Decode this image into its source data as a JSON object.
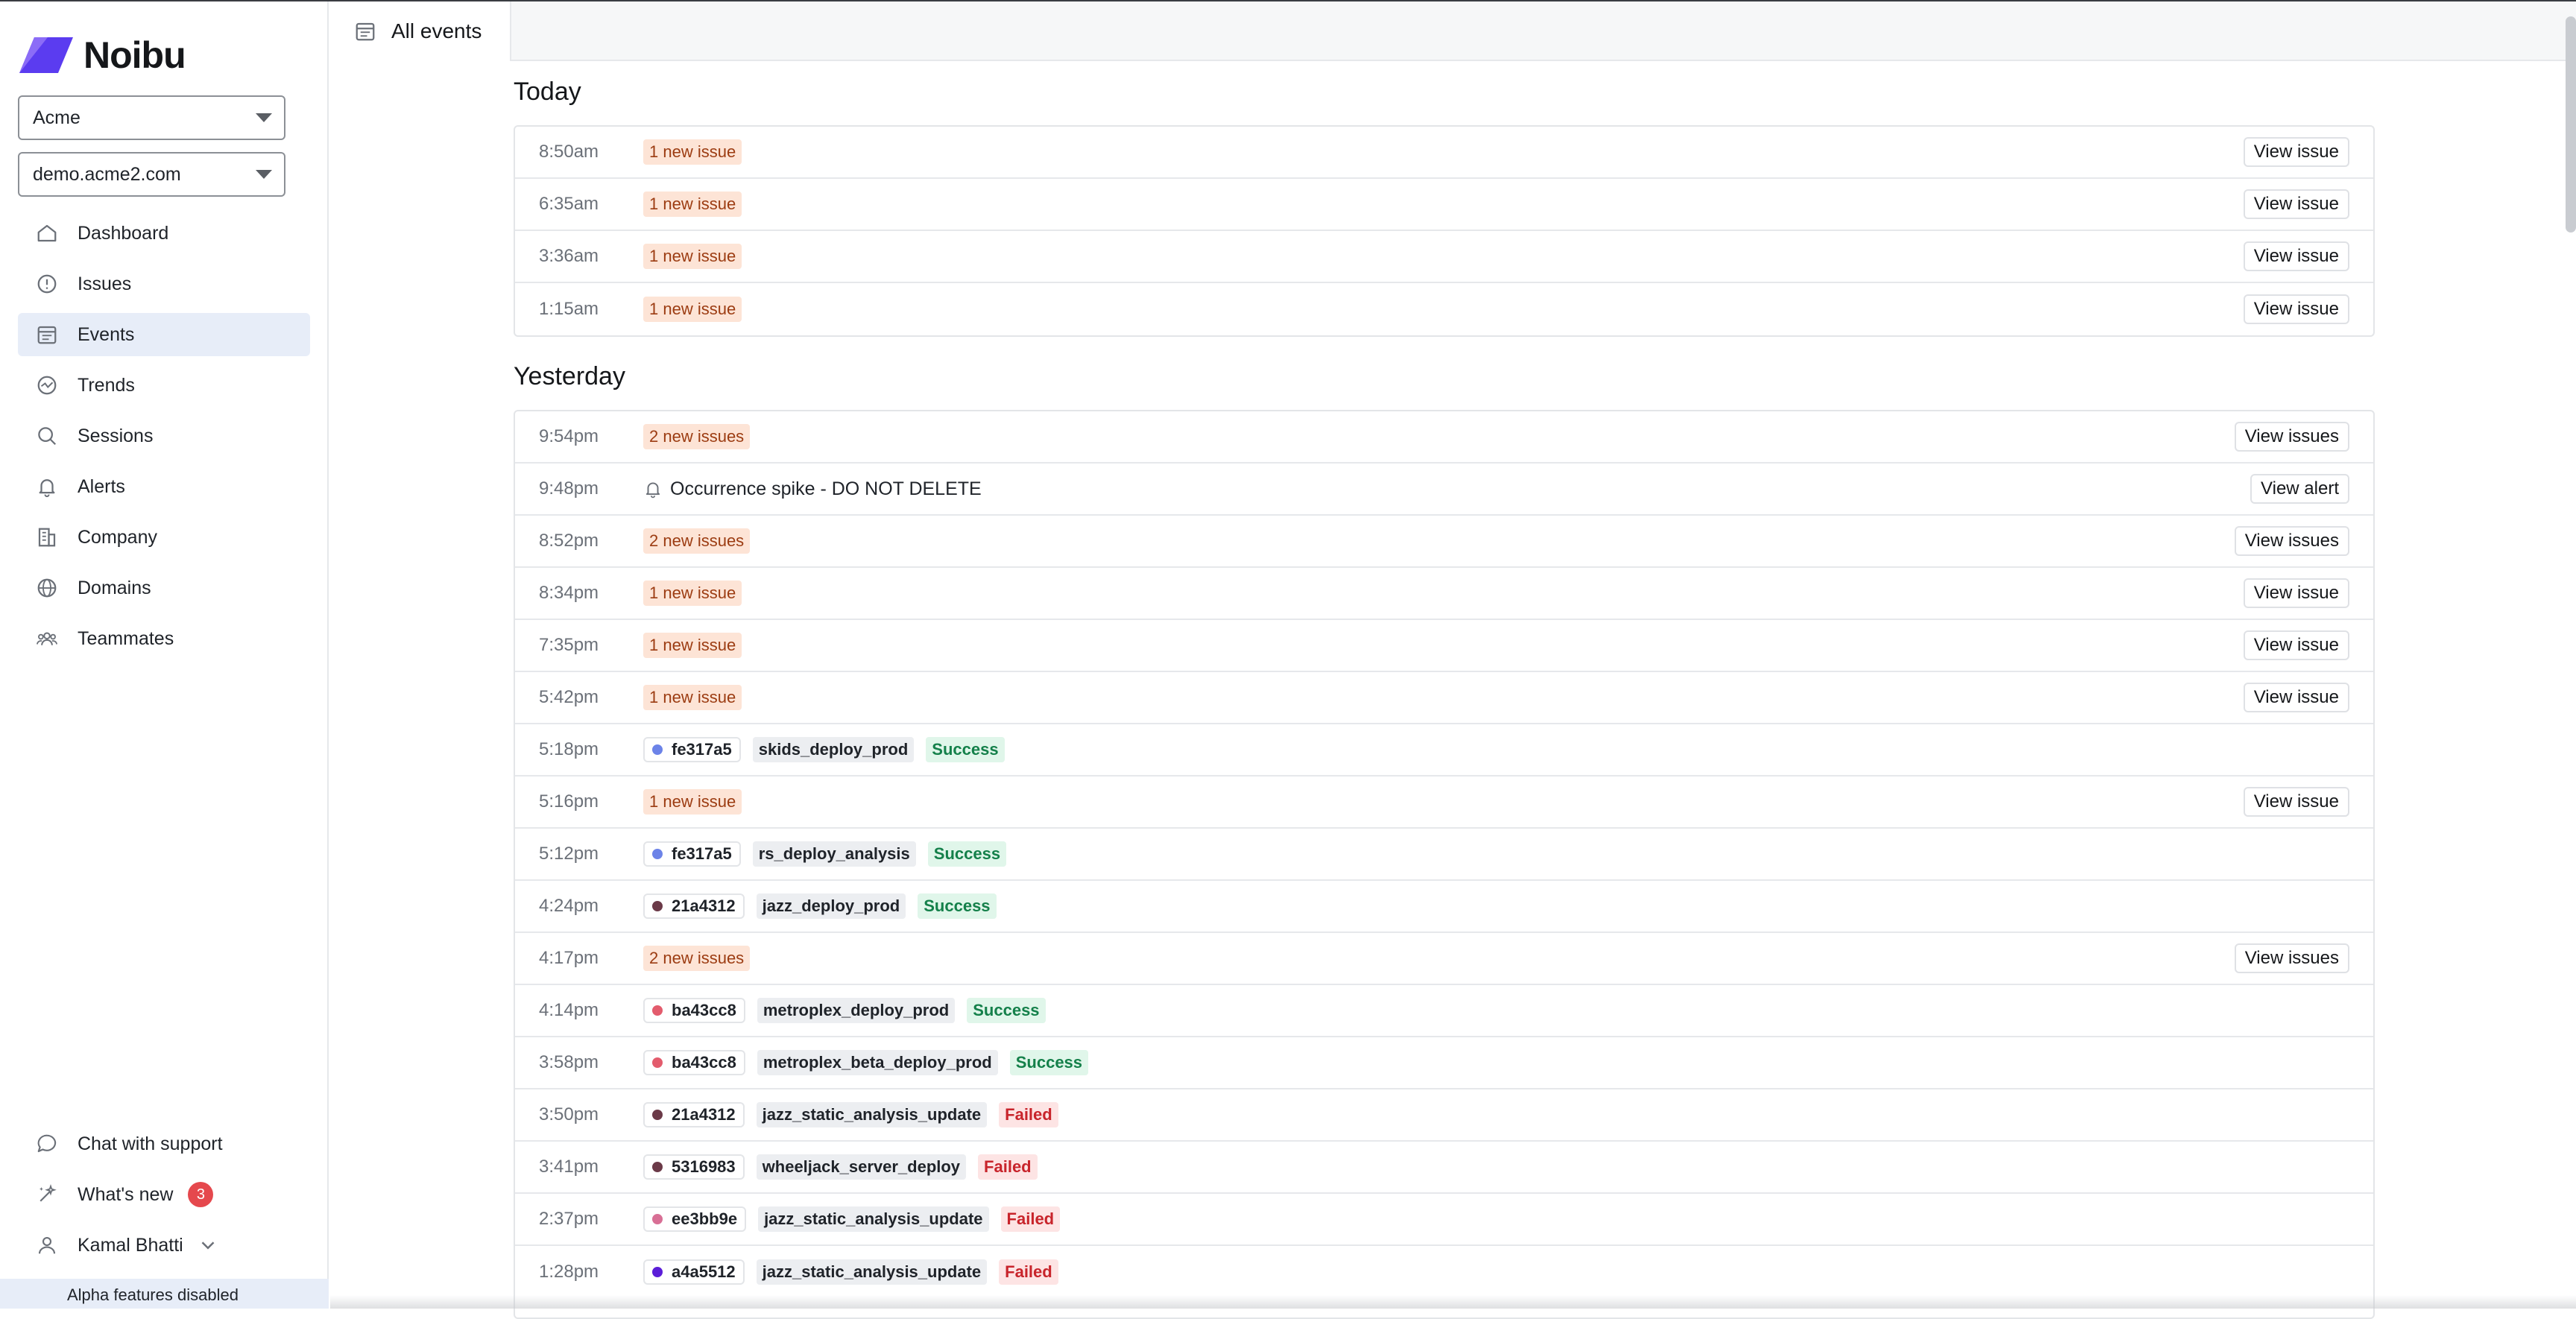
{
  "sidebar": {
    "brand": "Noibu",
    "org_select": "Acme",
    "domain_select": "demo.acme2.com",
    "nav": [
      {
        "label": "Dashboard",
        "icon": "home-icon"
      },
      {
        "label": "Issues",
        "icon": "alert-circle-icon"
      },
      {
        "label": "Events",
        "icon": "calendar-icon",
        "active": true
      },
      {
        "label": "Trends",
        "icon": "trend-icon"
      },
      {
        "label": "Sessions",
        "icon": "search-icon"
      },
      {
        "label": "Alerts",
        "icon": "bell-icon"
      },
      {
        "label": "Company",
        "icon": "building-icon"
      },
      {
        "label": "Domains",
        "icon": "globe-icon"
      },
      {
        "label": "Teammates",
        "icon": "users-icon"
      }
    ],
    "bottom": {
      "chat": "Chat with support",
      "whats_new": "What's new",
      "whats_new_count": "3",
      "user": "Kamal Bhatti",
      "alpha": "Alpha features disabled"
    }
  },
  "topbar": {
    "tab_label": "All events"
  },
  "colors": {
    "accent": "#5b3cf0",
    "issue_bg": "#fde4d6",
    "success_bg": "#e0f6ea",
    "failed_bg": "#fde4e4"
  },
  "today": {
    "title": "Today",
    "rows": [
      {
        "time": "8:50am",
        "issue": "1 new issue",
        "action": "View issue"
      },
      {
        "time": "6:35am",
        "issue": "1 new issue",
        "action": "View issue"
      },
      {
        "time": "3:36am",
        "issue": "1 new issue",
        "action": "View issue"
      },
      {
        "time": "1:15am",
        "issue": "1 new issue",
        "action": "View issue"
      }
    ]
  },
  "yesterday": {
    "title": "Yesterday",
    "rows": [
      {
        "time": "9:54pm",
        "issue": "2 new issues",
        "action": "View issues"
      },
      {
        "time": "9:48pm",
        "alert": "Occurrence spike - DO NOT DELETE",
        "action": "View alert"
      },
      {
        "time": "8:52pm",
        "issue": "2 new issues",
        "action": "View issues"
      },
      {
        "time": "8:34pm",
        "issue": "1 new issue",
        "action": "View issue"
      },
      {
        "time": "7:35pm",
        "issue": "1 new issue",
        "action": "View issue"
      },
      {
        "time": "5:42pm",
        "issue": "1 new issue",
        "action": "View issue"
      },
      {
        "time": "5:18pm",
        "commit": "fe317a5",
        "dot": "#6c83e8",
        "job": "skids_deploy_prod",
        "status": "Success"
      },
      {
        "time": "5:16pm",
        "issue": "1 new issue",
        "action": "View issue"
      },
      {
        "time": "5:12pm",
        "commit": "fe317a5",
        "dot": "#6c83e8",
        "job": "rs_deploy_analysis",
        "status": "Success"
      },
      {
        "time": "4:24pm",
        "commit": "21a4312",
        "dot": "#6b3a48",
        "job": "jazz_deploy_prod",
        "status": "Success"
      },
      {
        "time": "4:17pm",
        "issue": "2 new issues",
        "action": "View issues"
      },
      {
        "time": "4:14pm",
        "commit": "ba43cc8",
        "dot": "#e35c6d",
        "job": "metroplex_deploy_prod",
        "status": "Success"
      },
      {
        "time": "3:58pm",
        "commit": "ba43cc8",
        "dot": "#e35c6d",
        "job": "metroplex_beta_deploy_prod",
        "status": "Success"
      },
      {
        "time": "3:50pm",
        "commit": "21a4312",
        "dot": "#6b3a48",
        "job": "jazz_static_analysis_update",
        "status": "Failed"
      },
      {
        "time": "3:41pm",
        "commit": "5316983",
        "dot": "#6b3a48",
        "job": "wheeljack_server_deploy",
        "status": "Failed"
      },
      {
        "time": "2:37pm",
        "commit": "ee3bb9e",
        "dot": "#d86f95",
        "job": "jazz_static_analysis_update",
        "status": "Failed"
      },
      {
        "time": "1:28pm",
        "commit": "a4a5512",
        "dot": "#5b1ed8",
        "job": "jazz_static_analysis_update",
        "status": "Failed"
      }
    ]
  }
}
